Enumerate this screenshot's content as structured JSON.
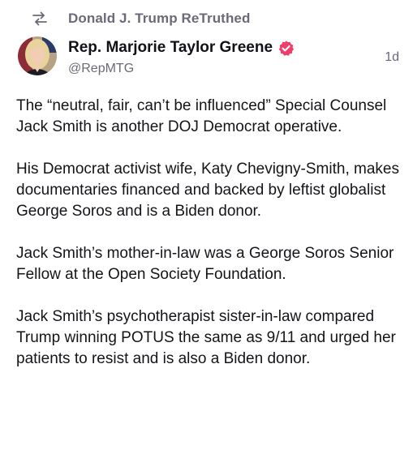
{
  "retruth": {
    "label": "Donald J. Trump ReTruthed",
    "icon": "retruth-icon"
  },
  "author": {
    "display_name": "Rep. Marjorie Taylor Greene",
    "handle": "@RepMTG",
    "verified": true,
    "badge_color": "#ef3e6b",
    "timestamp": "1d"
  },
  "post": {
    "paragraphs": [
      "The “neutral, fair, can’t be influenced” Special Counsel Jack Smith is another DOJ Democrat operative.",
      "His Democrat activist wife, Katy Chevigny-Smith, makes documentaries financed and backed by leftist globalist George Soros and is a Biden donor.",
      "Jack Smith’s mother-in-law was a George Soros Senior Fellow at the Open Society Foundation.",
      "Jack Smith’s psychotherapist sister-in-law compared Trump winning POTUS the same as 9/11 and urged her patients to resist and is also a Biden donor."
    ]
  },
  "colors": {
    "muted_text": "#6b6a78",
    "body_text": "#141419",
    "background": "#ffffff"
  }
}
